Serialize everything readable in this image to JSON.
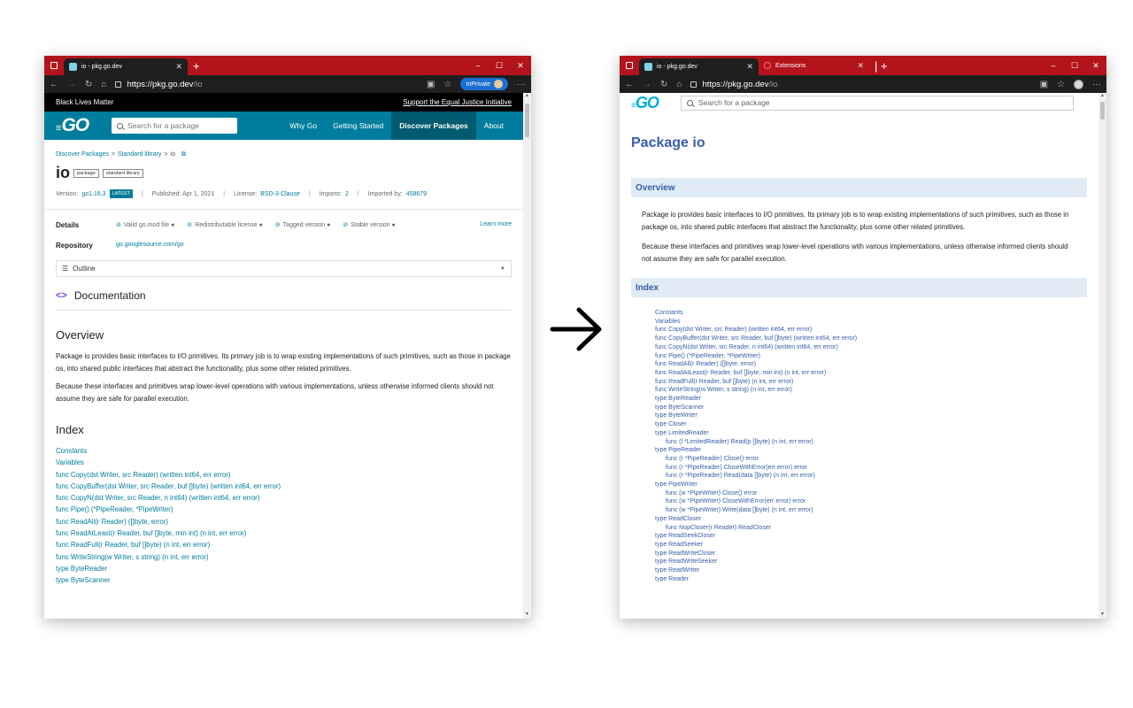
{
  "left": {
    "browser": {
      "tab_title": "io - pkg.go.dev",
      "url_host": "https://pkg.go.dev",
      "url_path": "/io",
      "inprivate": "InPrivate",
      "controls": [
        "–",
        "☐",
        "✕"
      ]
    },
    "banner": {
      "text": "Black Lives Matter",
      "link": "Support the Equal Justice Initiative"
    },
    "header": {
      "search_placeholder": "Search for a package",
      "nav": [
        "Why Go",
        "Getting Started",
        "Discover Packages",
        "About"
      ],
      "active_nav": "Discover Packages"
    },
    "breadcrumb": [
      "Discover Packages",
      "Standard library",
      "io"
    ],
    "package": {
      "name": "io",
      "chips": [
        "package",
        "standard library"
      ],
      "version_label": "Version:",
      "version": "go1.16.3",
      "latest": "LATEST",
      "published": "Published: Apr 1, 2021",
      "license_label": "License:",
      "license": "BSD-3-Clause",
      "imports_label": "Imports:",
      "imports": "2",
      "imported_by_label": "Imported by:",
      "imported_by": "458679"
    },
    "details": {
      "label": "Details",
      "items": [
        "Valid go.mod file",
        "Redistributable license",
        "Tagged version",
        "Stable version"
      ],
      "learn_more": "Learn more"
    },
    "repository": {
      "label": "Repository",
      "value": "go.googlesource.com/go"
    },
    "outline": "Outline",
    "documentation": "Documentation",
    "overview_heading": "Overview",
    "overview_p1": "Package io provides basic interfaces to I/O primitives. Its primary job is to wrap existing implementations of such primitives, such as those in package os, into shared public interfaces that abstract the functionality, plus some other related primitives.",
    "overview_p2": "Because these interfaces and primitives wrap lower-level operations with various implementations, unless otherwise informed clients should not assume they are safe for parallel execution.",
    "index_heading": "Index",
    "index": [
      "Constants",
      "Variables",
      "func Copy(dst Writer, src Reader) (written int64, err error)",
      "func CopyBuffer(dst Writer, src Reader, buf []byte) (written int64, err error)",
      "func CopyN(dst Writer, src Reader, n int64) (written int64, err error)",
      "func Pipe() (*PipeReader, *PipeWriter)",
      "func ReadAll(r Reader) ([]byte, error)",
      "func ReadAtLeast(r Reader, buf []byte, min int) (n int, err error)",
      "func ReadFull(r Reader, buf []byte) (n int, err error)",
      "func WriteString(w Writer, s string) (n int, err error)",
      "type ByteReader",
      "type ByteScanner"
    ]
  },
  "right": {
    "browser": {
      "tab_title": "io - pkg.go.dev",
      "tab2_title": "Extensions",
      "url_host": "https://pkg.go.dev",
      "url_path": "/io"
    },
    "search_placeholder": "Search for a package",
    "title": "Package io",
    "overview_heading": "Overview",
    "overview_p1": "Package io provides basic interfaces to I/O primitives. Its primary job is to wrap existing implementations of such primitives, such as those in package os, into shared public interfaces that abstract the functionality, plus some other related primitives.",
    "overview_p2": "Because these interfaces and primitives wrap lower-level operations with various implementations, unless otherwise informed clients should not assume they are safe for parallel execution.",
    "index_heading": "Index",
    "index": [
      {
        "text": "Constants",
        "indent": false
      },
      {
        "text": "Variables",
        "indent": false
      },
      {
        "text": "func Copy(dst Writer, src Reader) (written int64, err error)",
        "indent": false
      },
      {
        "text": "func CopyBuffer(dst Writer, src Reader, buf []byte) (written int64, err error)",
        "indent": false
      },
      {
        "text": "func CopyN(dst Writer, src Reader, n int64) (written int64, err error)",
        "indent": false
      },
      {
        "text": "func Pipe() (*PipeReader, *PipeWriter)",
        "indent": false
      },
      {
        "text": "func ReadAll(r Reader) ([]byte, error)",
        "indent": false
      },
      {
        "text": "func ReadAtLeast(r Reader, buf []byte, min int) (n int, err error)",
        "indent": false
      },
      {
        "text": "func ReadFull(r Reader, buf []byte) (n int, err error)",
        "indent": false
      },
      {
        "text": "func WriteString(w Writer, s string) (n int, err error)",
        "indent": false
      },
      {
        "text": "type ByteReader",
        "indent": false
      },
      {
        "text": "type ByteScanner",
        "indent": false
      },
      {
        "text": "type ByteWriter",
        "indent": false
      },
      {
        "text": "type Closer",
        "indent": false
      },
      {
        "text": "type LimitedReader",
        "indent": false
      },
      {
        "text": "func (l *LimitedReader) Read(p []byte) (n int, err error)",
        "indent": true
      },
      {
        "text": "type PipeReader",
        "indent": false
      },
      {
        "text": "func (r *PipeReader) Close() error",
        "indent": true
      },
      {
        "text": "func (r *PipeReader) CloseWithError(err error) error",
        "indent": true
      },
      {
        "text": "func (r *PipeReader) Read(data []byte) (n int, err error)",
        "indent": true
      },
      {
        "text": "type PipeWriter",
        "indent": false
      },
      {
        "text": "func (w *PipeWriter) Close() error",
        "indent": true
      },
      {
        "text": "func (w *PipeWriter) CloseWithError(err error) error",
        "indent": true
      },
      {
        "text": "func (w *PipeWriter) Write(data []byte) (n int, err error)",
        "indent": true
      },
      {
        "text": "type ReadCloser",
        "indent": false
      },
      {
        "text": "func NopCloser(r Reader) ReadCloser",
        "indent": true
      },
      {
        "text": "type ReadSeekCloser",
        "indent": false
      },
      {
        "text": "type ReadSeeker",
        "indent": false
      },
      {
        "text": "type ReadWriteCloser",
        "indent": false
      },
      {
        "text": "type ReadWriteSeeker",
        "indent": false
      },
      {
        "text": "type ReadWriter",
        "indent": false
      },
      {
        "text": "type Reader",
        "indent": false
      }
    ]
  },
  "colors": {
    "titlebar": "#b3141c",
    "go_blue": "#007d9c",
    "legacy_blue": "#375eab",
    "section_bg": "#e0ebf5"
  }
}
